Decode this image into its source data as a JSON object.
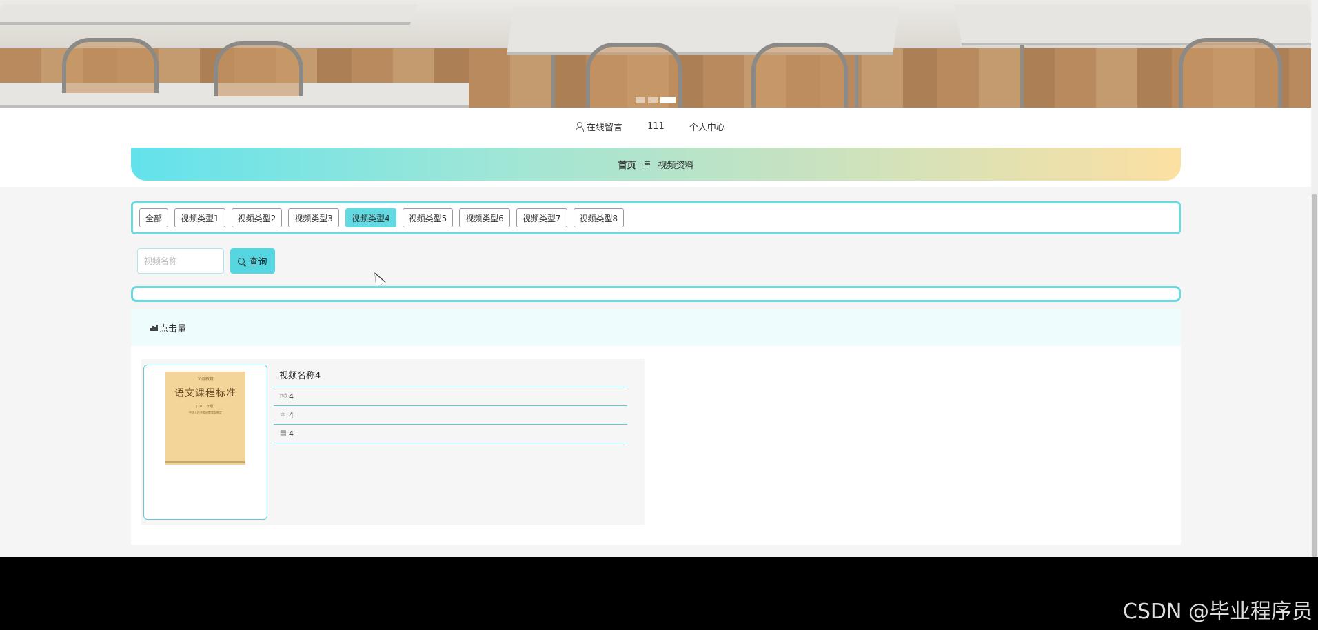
{
  "banner": {
    "slides": 3,
    "active_slide": 3
  },
  "toplinks": {
    "messages": "在线留言",
    "username": "111",
    "profile": "个人中心"
  },
  "nav": {
    "home": "首页",
    "videos": "视频资料"
  },
  "categories": [
    {
      "label": "全部",
      "active": false
    },
    {
      "label": "视频类型1",
      "active": false
    },
    {
      "label": "视频类型2",
      "active": false
    },
    {
      "label": "视频类型3",
      "active": false
    },
    {
      "label": "视频类型4",
      "active": true
    },
    {
      "label": "视频类型5",
      "active": false
    },
    {
      "label": "视频类型6",
      "active": false
    },
    {
      "label": "视频类型7",
      "active": false
    },
    {
      "label": "视频类型8",
      "active": false
    }
  ],
  "search": {
    "placeholder": "视频名称",
    "value": "",
    "button": "查询"
  },
  "sort": {
    "label": "点击量"
  },
  "book_cover": {
    "top": "义务教育",
    "title": "语文课程标准",
    "edition": "(2011年版)",
    "publisher": "中华人民共和国教育部制定"
  },
  "items": [
    {
      "name": "视频名称4",
      "likes": "4",
      "favorites": "4",
      "clicks": "4"
    }
  ],
  "watermark": "CSDN @毕业程序员",
  "colors": {
    "accent": "#63d9e2",
    "nav_gradient_start": "#63e2ec",
    "nav_gradient_end": "#fce0a2"
  }
}
